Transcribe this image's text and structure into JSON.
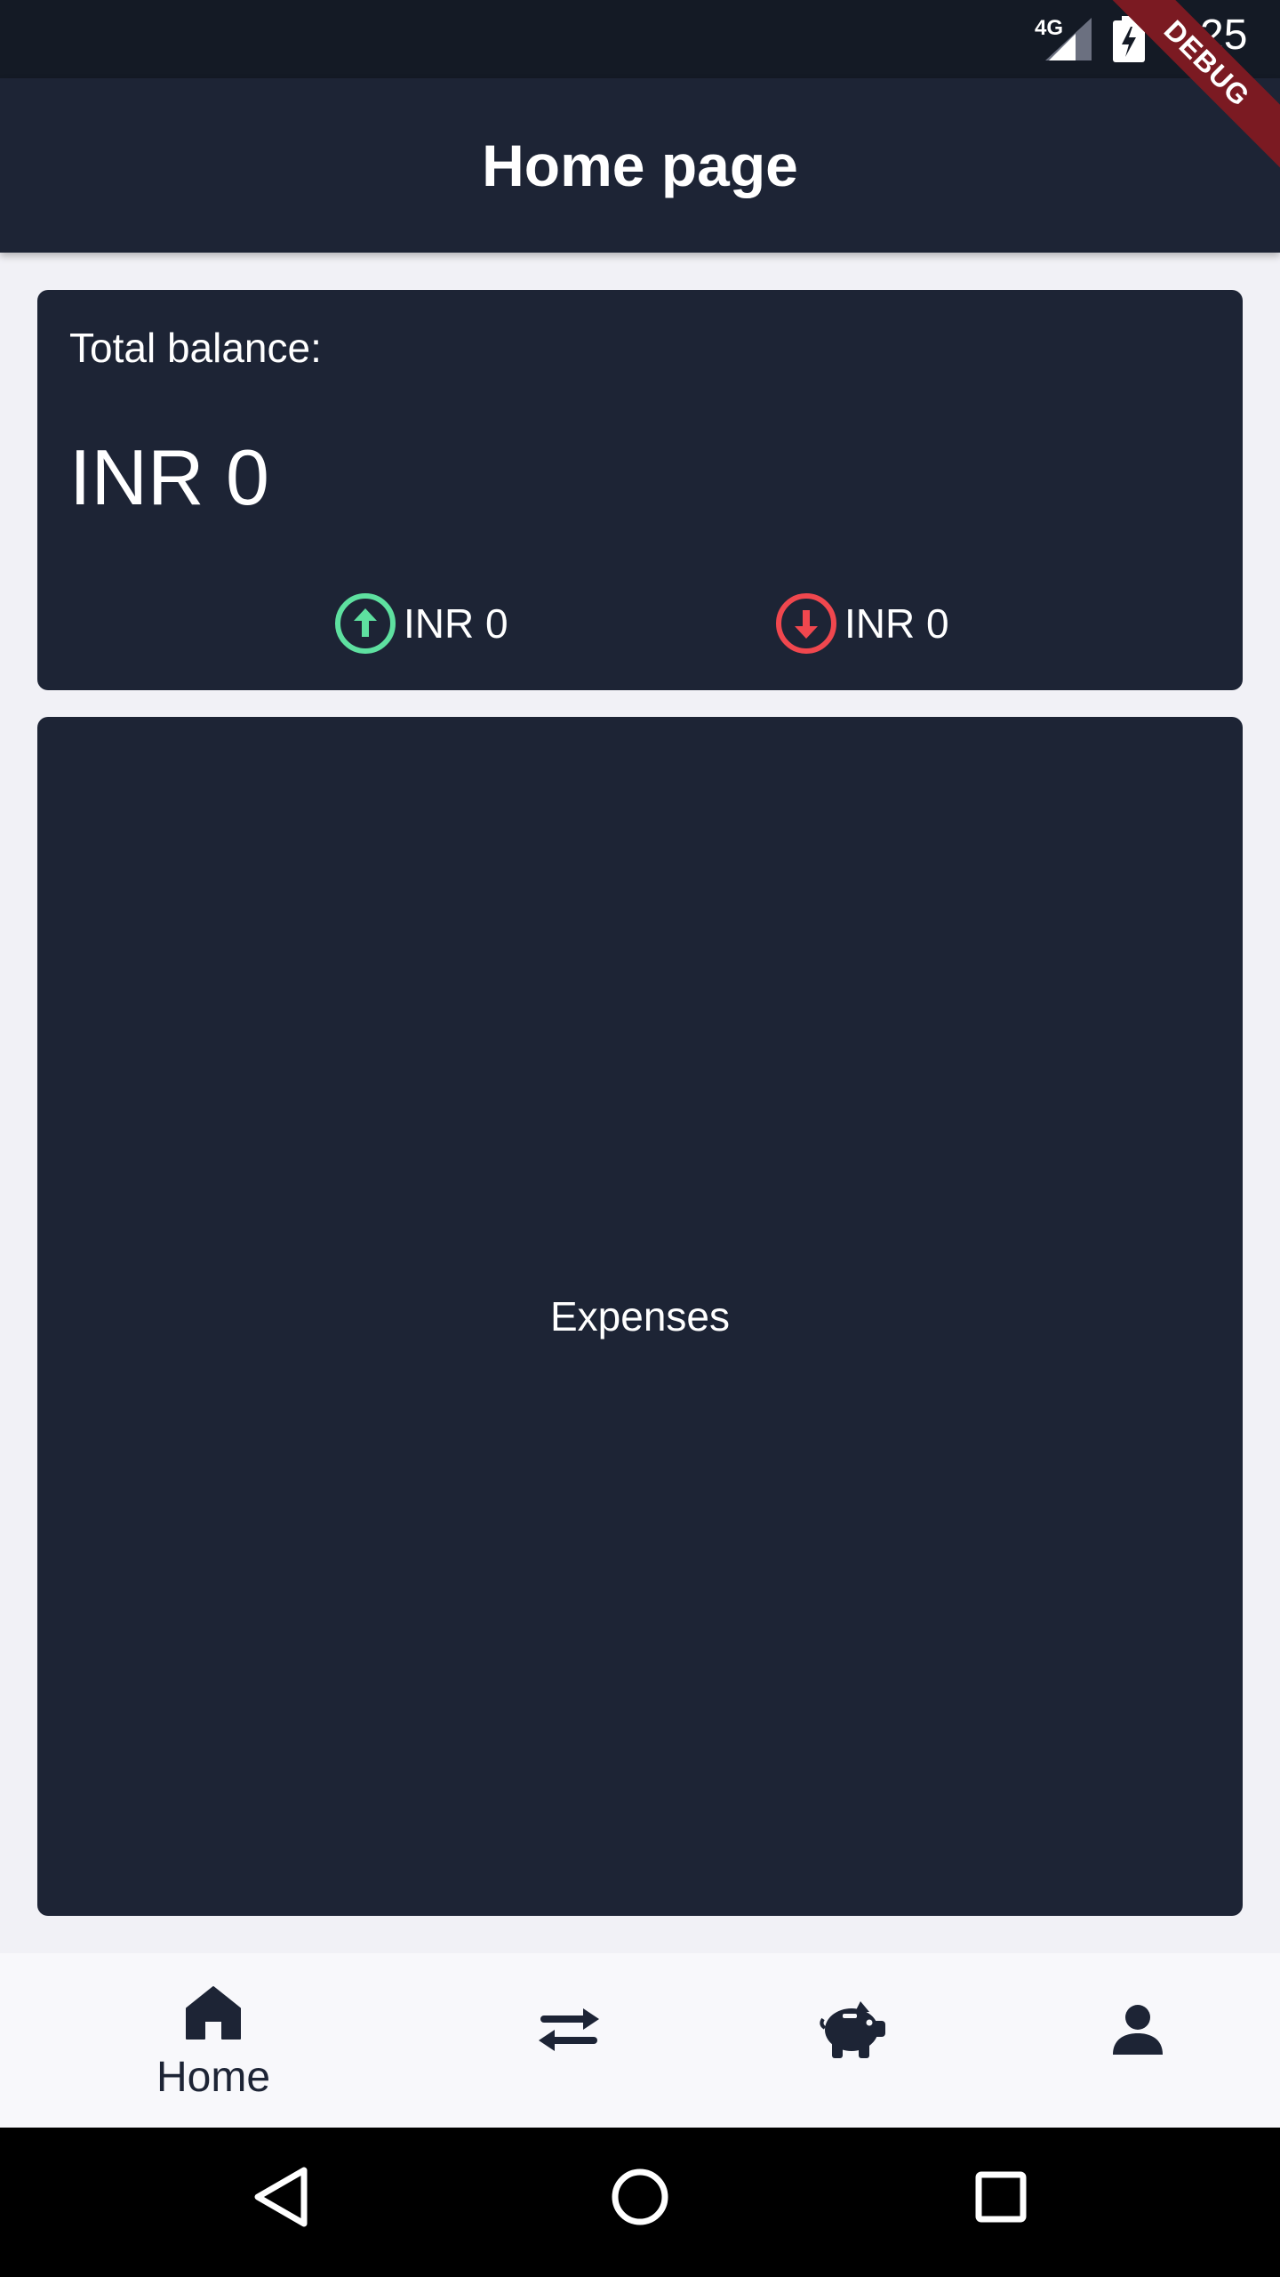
{
  "status_bar": {
    "network": "4G",
    "time": "8:25",
    "debug_label": "DEBUG"
  },
  "app_bar": {
    "title": "Home page"
  },
  "balance_card": {
    "label": "Total balance:",
    "value": "INR 0",
    "income": "INR 0",
    "expense": "INR 0",
    "income_color": "#5ee0a0",
    "expense_color": "#f0474e"
  },
  "expenses_card": {
    "label": "Expenses"
  },
  "bottom_nav": {
    "items": [
      {
        "icon": "home-icon",
        "label": "Home",
        "selected": true
      },
      {
        "icon": "transfer-icon",
        "label": "",
        "selected": false
      },
      {
        "icon": "piggy-bank-icon",
        "label": "",
        "selected": false
      },
      {
        "icon": "person-icon",
        "label": "",
        "selected": false
      }
    ]
  },
  "colors": {
    "app_bar": "#1d2435",
    "card": "#1d2435",
    "background": "#f1f1f6",
    "status_bar": "#141a25",
    "debug_ribbon": "#7b1a22"
  }
}
